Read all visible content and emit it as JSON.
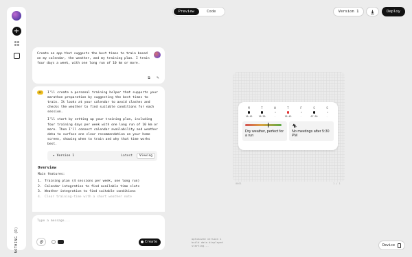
{
  "rail": {
    "brand": "NOTHING (R)",
    "icons": [
      "avatar",
      "plus-icon",
      "grid-icon",
      "square-icon"
    ]
  },
  "topbar": {
    "preview_label": "Preview",
    "code_label": "Code",
    "active_tab": "Preview",
    "version_label": "Version 1",
    "deploy_label": "Deploy"
  },
  "chat": {
    "user_message": "Create an app that suggests the best times to train based on my calendar, the weather, and my training plan. I train four days a week, with one long run of 10 km or more.",
    "ai_badge": "AI",
    "ai_paragraphs": [
      "I'll create a personal training helper that supports your marathon preparation by suggesting the best times to train. It looks at your calendar to avoid clashes and checks the weather to find suitable conditions for each session.",
      "I'll start by setting up your training plan, including four training days per week with one long run of 10 km or more. Then I'll connect calendar availability and weather data to surface one clear recommendation on your home screen, showing when to train and why that time works best."
    ],
    "version_card": {
      "label": "Version 1",
      "latest": "Latest",
      "viewing": "Viewing"
    },
    "overview_title": "Overview",
    "features_title": "Main features:",
    "features": [
      {
        "num": "1.",
        "text": "Training plan (4 sessions per week, one long run)"
      },
      {
        "num": "2.",
        "text": "Calendar integration to find available time slots"
      },
      {
        "num": "3.",
        "text": "Weather integration to find suitable conditions"
      },
      {
        "num": "4.",
        "text": "Clear training-time with a short weather note"
      }
    ],
    "composer_placeholder": "Type a message...",
    "create_label": "Create"
  },
  "preview": {
    "footer_left": "0001",
    "footer_right": "1 / 1",
    "days": [
      {
        "letter": "M",
        "dot": "black",
        "time": "16:45"
      },
      {
        "letter": "T",
        "dot": "black",
        "time": "18:30"
      },
      {
        "letter": "W",
        "dot": "none",
        "time": "—"
      },
      {
        "letter": "T",
        "dot": "red",
        "time": "18:45"
      },
      {
        "letter": "F",
        "dot": "none",
        "time": "—"
      },
      {
        "letter": "S",
        "dot": "black",
        "time": "07:30"
      },
      {
        "letter": "S",
        "dot": "none",
        "time": "—"
      }
    ],
    "weather_level": 0.62,
    "weather_text": "Dry weather, perfect for a run",
    "calendar_text": "No meetings after 5:30 PM"
  },
  "deploy_log": [
    "optimized version 1",
    "build data displayed",
    "starting..."
  ],
  "device_label": "Device"
}
